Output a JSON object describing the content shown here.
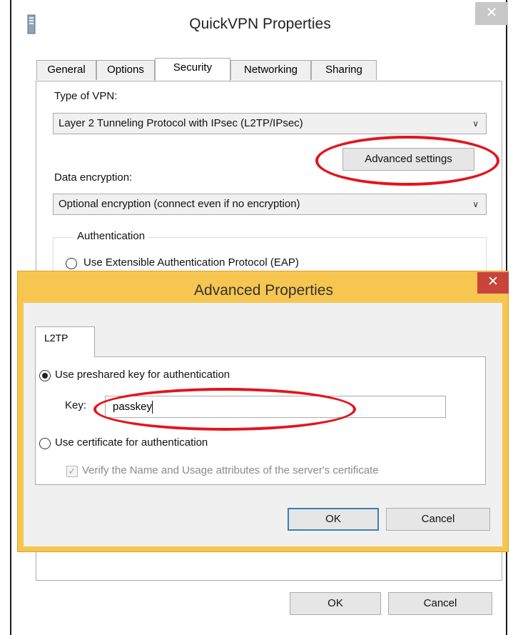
{
  "outer": {
    "title": "QuickVPN Properties",
    "close_glyph": "✕",
    "tabs": [
      "General",
      "Options",
      "Security",
      "Networking",
      "Sharing"
    ],
    "active_tab": "Security",
    "type_label": "Type of VPN:",
    "type_value": "Layer 2 Tunneling Protocol with IPsec (L2TP/IPsec)",
    "advanced_button": "Advanced settings",
    "encryption_label": "Data encryption:",
    "encryption_value": "Optional encryption (connect even if no encryption)",
    "auth_legend": "Authentication",
    "eap_option": "Use Extensible Authentication Protocol (EAP)",
    "ok": "OK",
    "cancel": "Cancel"
  },
  "advanced": {
    "title": "Advanced Properties",
    "close_glyph": "✕",
    "tab": "L2TP",
    "preshared_option": "Use preshared key for authentication",
    "preshared_selected": true,
    "key_label": "Key:",
    "key_value": "passkey",
    "certificate_option": "Use certificate for authentication",
    "verify_option": "Verify the Name and Usage attributes of the server's certificate",
    "verify_checked": true,
    "ok": "OK",
    "cancel": "Cancel"
  },
  "colors": {
    "highlight_ellipse": "#e3141c",
    "advanced_frame": "#f6c650",
    "close_red": "#c8443a"
  },
  "icons": [
    "app-icon",
    "close-icon",
    "chevron-down-icon",
    "radio-icon",
    "checkbox-icon"
  ]
}
